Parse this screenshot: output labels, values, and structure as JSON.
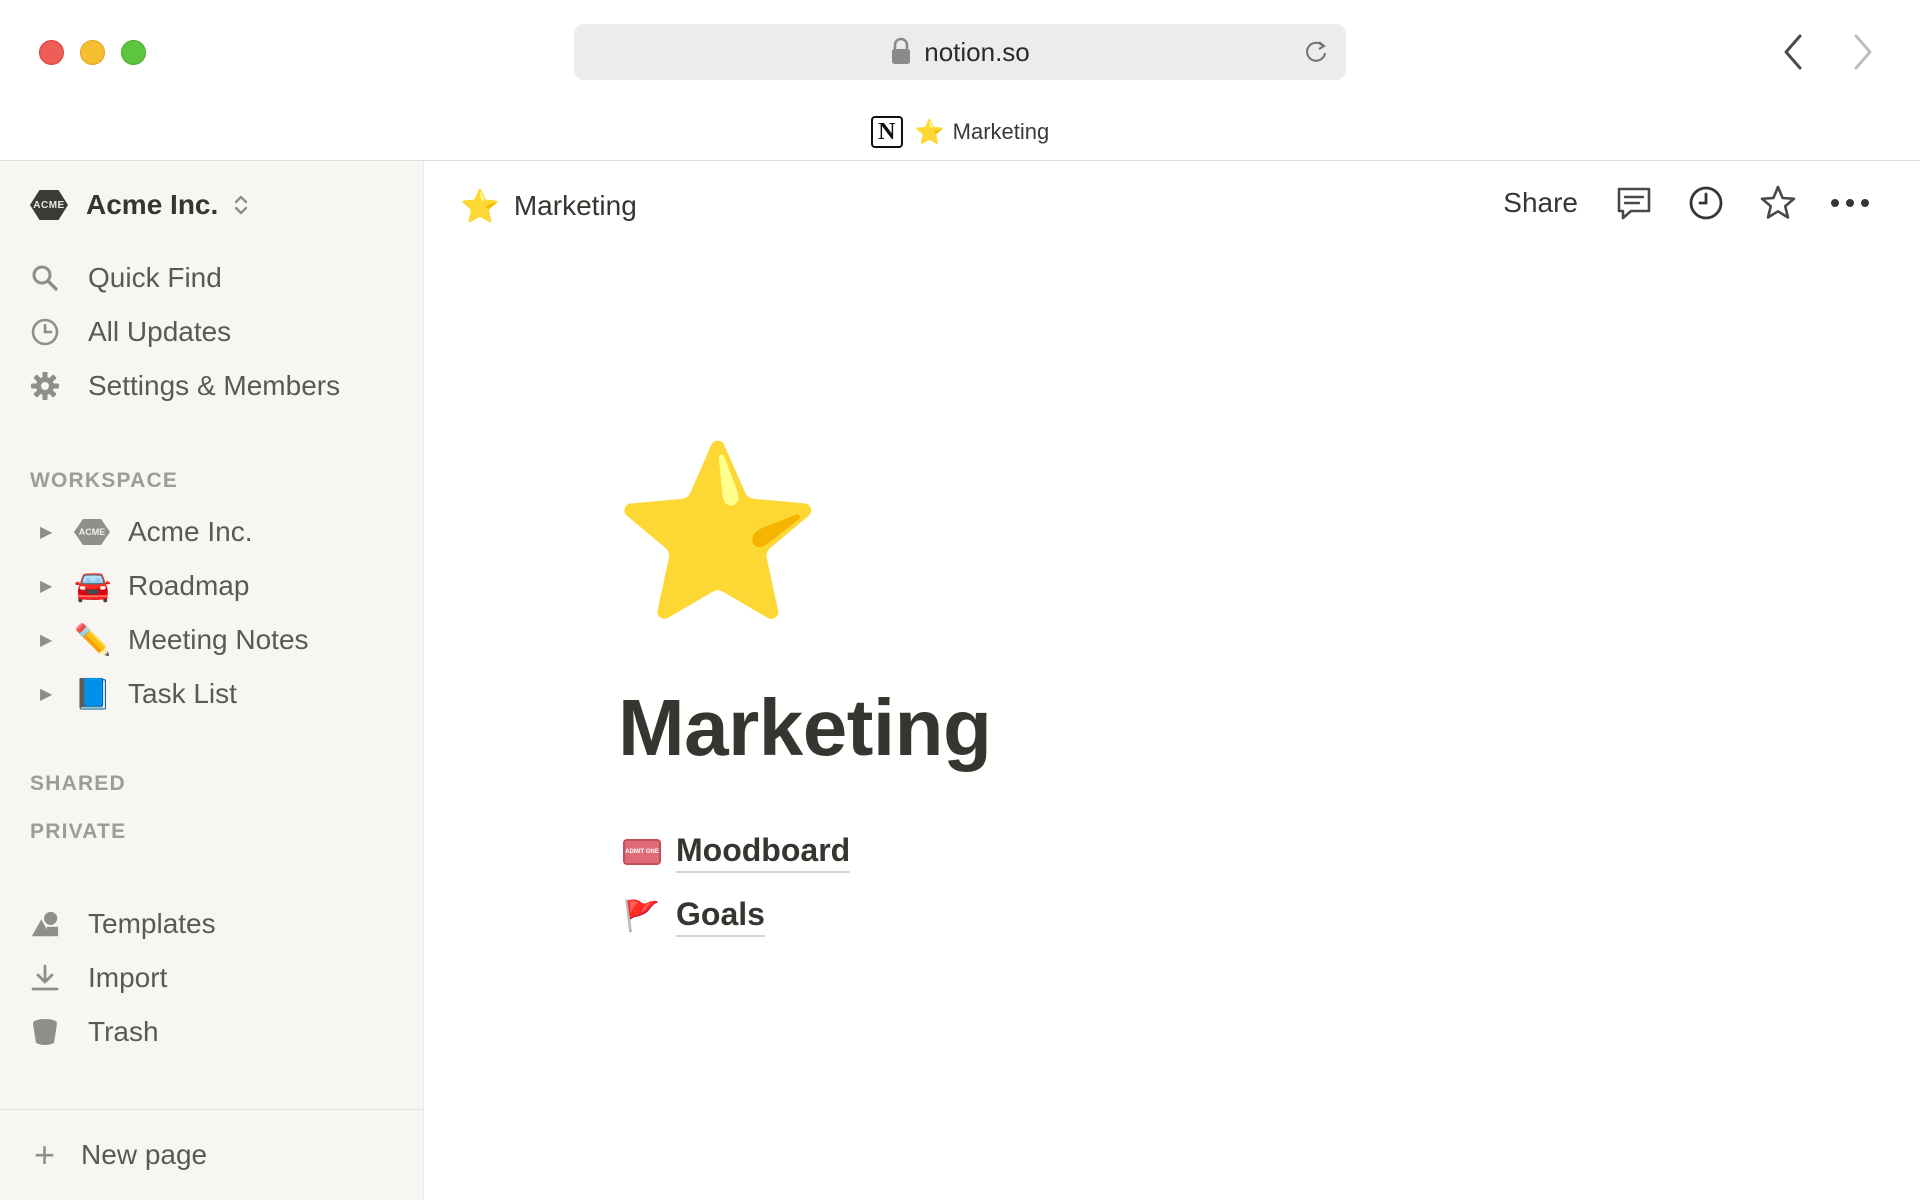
{
  "browser": {
    "url": "notion.so",
    "tab": {
      "title": "Marketing",
      "icon": "star-emoji",
      "logo_letter": "N"
    }
  },
  "sidebar": {
    "workspace": {
      "name": "Acme Inc.",
      "badge": "ACME"
    },
    "nav": [
      {
        "label": "Quick Find",
        "icon": "search-icon"
      },
      {
        "label": "All Updates",
        "icon": "clock-icon"
      },
      {
        "label": "Settings & Members",
        "icon": "gear-icon"
      }
    ],
    "sections": {
      "workspace": "WORKSPACE",
      "shared": "SHARED",
      "private": "PRIVATE"
    },
    "tree": [
      {
        "label": "Acme Inc.",
        "icon": "acme-logo-icon",
        "badge": "ACME"
      },
      {
        "label": "Roadmap",
        "icon": "car-emoji",
        "emoji": "🚘"
      },
      {
        "label": "Meeting Notes",
        "icon": "pencil-emoji",
        "emoji": "✏️"
      },
      {
        "label": "Task List",
        "icon": "book-emoji",
        "emoji": "📘"
      }
    ],
    "footer_nav": [
      {
        "label": "Templates",
        "icon": "shapes-icon"
      },
      {
        "label": "Import",
        "icon": "download-icon"
      },
      {
        "label": "Trash",
        "icon": "trash-icon"
      }
    ],
    "new_page": "New page"
  },
  "topbar": {
    "breadcrumb": {
      "label": "Marketing",
      "emoji": "⭐"
    },
    "share_label": "Share"
  },
  "page": {
    "icon": "⭐",
    "title": "Marketing",
    "subpages": [
      {
        "label": "Moodboard",
        "icon": "ticket-emoji",
        "ticket_text": "ADMIT ONE"
      },
      {
        "label": "Goals",
        "icon": "flag-emoji",
        "emoji": "🚩"
      }
    ]
  },
  "colors": {
    "sidebar_bg": "#f7f6f3",
    "text": "#37352f",
    "muted": "#9d9c98"
  }
}
